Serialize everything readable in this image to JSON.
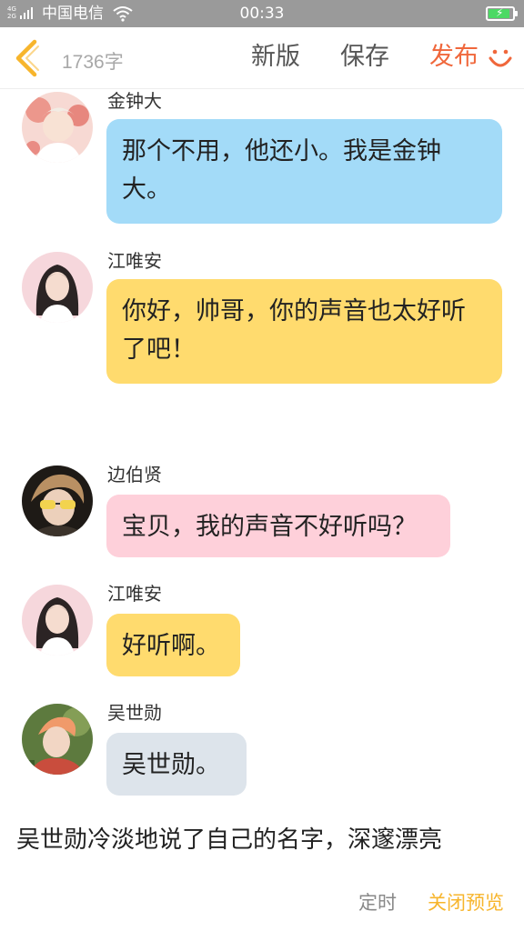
{
  "status_bar": {
    "network": "4G 2G",
    "carrier": "中国电信",
    "time": "00:33",
    "battery_level": 0.9,
    "battery_color": "#4cd964"
  },
  "toolbar": {
    "back_icon": "chevron-left-icon",
    "word_count": "1736字",
    "new_label": "新版",
    "save_label": "保存",
    "publish_label": "发布",
    "emoji_icon": "smile-icon",
    "accent_color": "#f0673b"
  },
  "messages": [
    {
      "sender": "金钟大",
      "text_line1": "那个不用，他还小。我是金钟",
      "text_line2": "大。",
      "bubble_color": "#a3dbf8"
    },
    {
      "sender": "江唯安",
      "text_line1": "你好，帅哥，你的声音也太好听",
      "text_line2": "了吧！",
      "bubble_color": "#ffdb6e"
    },
    {
      "sender": "边伯贤",
      "text_line1": "宝贝，我的声音不好听吗？",
      "bubble_color": "#fed0da"
    },
    {
      "sender": "江唯安",
      "text_line1": "好听啊。",
      "bubble_color": "#ffdb6e"
    },
    {
      "sender": "吴世勋",
      "text_line1": "吴世勋。",
      "bubble_color": "#dde4eb"
    }
  ],
  "narration": {
    "line1": "吴世勋冷淡地说了自己的名字，深邃漂亮"
  },
  "bottom_bar": {
    "schedule_label": "定时",
    "close_preview_label": "关闭预览",
    "close_preview_color": "#f7b52c"
  }
}
